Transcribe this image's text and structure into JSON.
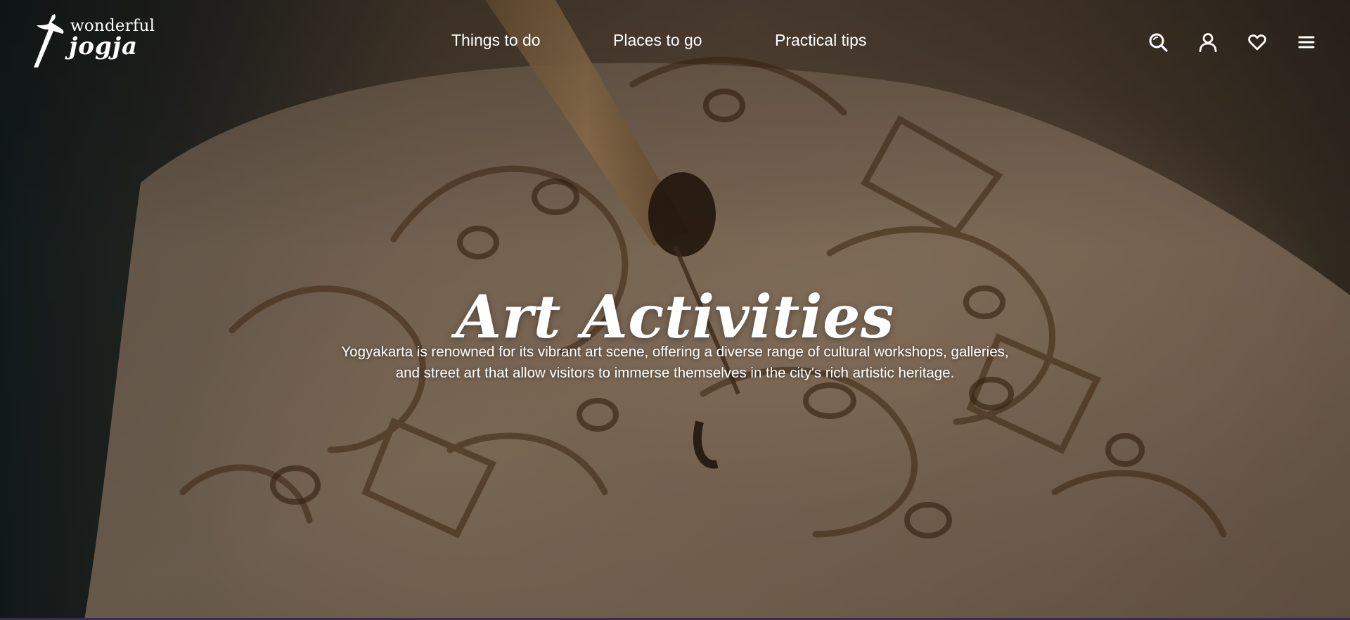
{
  "brand": {
    "line1": "wonderful",
    "line2": "jogja"
  },
  "nav": {
    "items": [
      {
        "label": "Things to do"
      },
      {
        "label": "Places to go"
      },
      {
        "label": "Practical tips"
      }
    ]
  },
  "header_icons": [
    "search-icon",
    "user-icon",
    "heart-icon",
    "menu-icon"
  ],
  "hero": {
    "title": "Art Activities",
    "description": "Yogyakarta is renowned for its vibrant art scene, offering a diverse range of cultural workshops, galleries, and street art that allow visitors to immerse themselves in the city's rich artistic heritage."
  },
  "colors": {
    "text": "#ffffff",
    "accent_bar": "#3c2a4e"
  }
}
